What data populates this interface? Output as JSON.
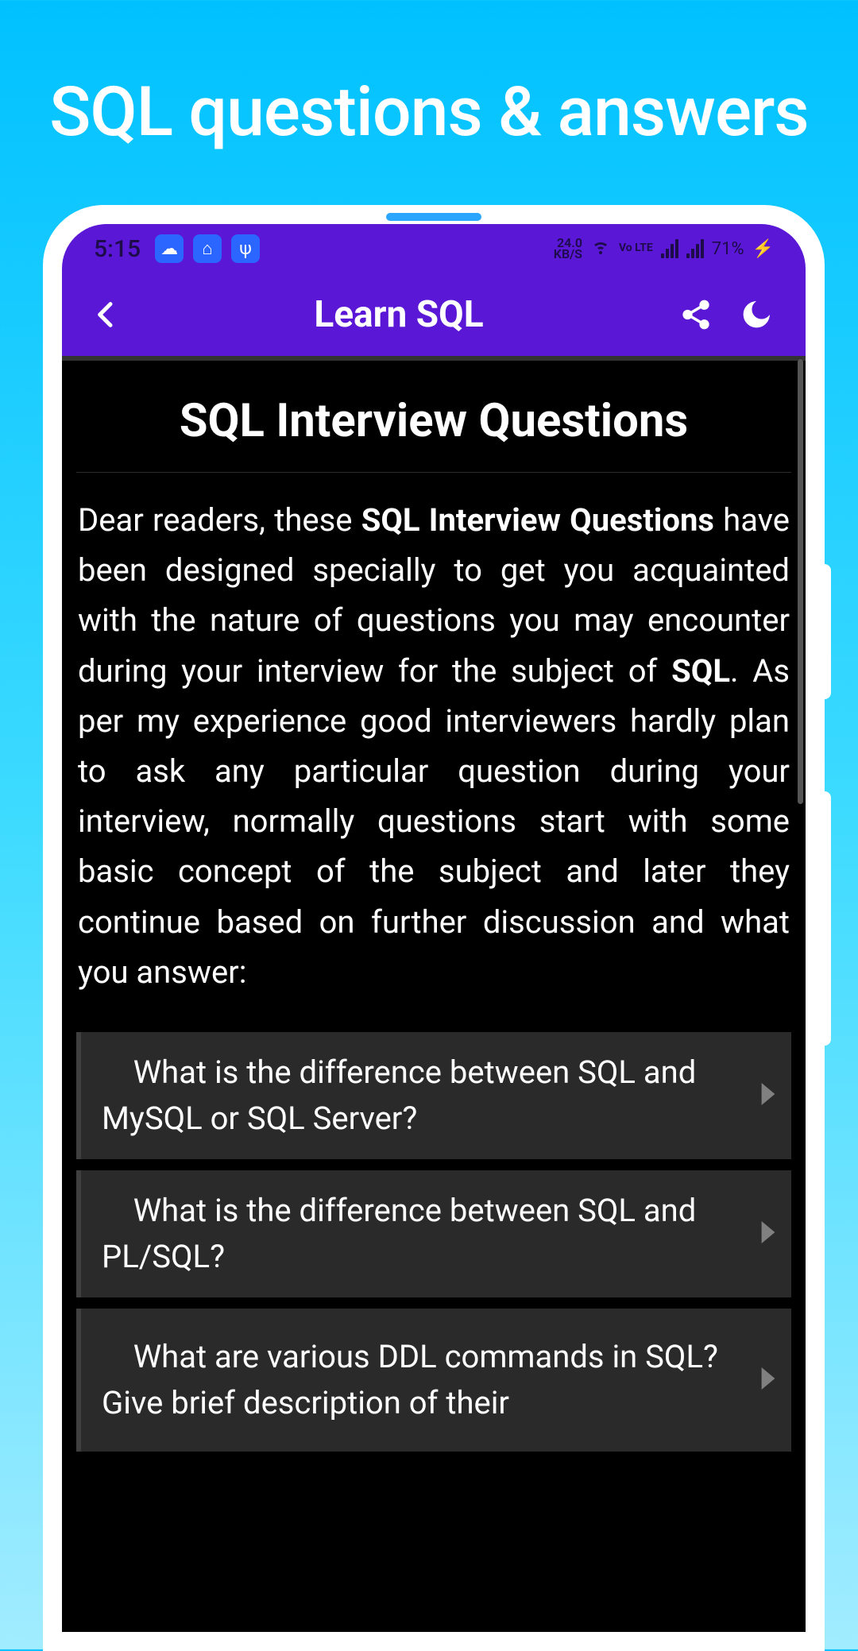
{
  "page_heading": "SQL questions & answers",
  "status": {
    "time": "5:15",
    "netspeed_top": "24.0",
    "netspeed_bottom": "KB/S",
    "volte": "Vo LTE",
    "battery": "71%",
    "charging": "⚡"
  },
  "appbar": {
    "title": "Learn SQL",
    "back_icon": "chevron-left",
    "share_icon": "share",
    "theme_icon": "moon"
  },
  "article": {
    "heading": "SQL Interview Questions",
    "intro_p1": "Dear readers, these ",
    "intro_b1": "SQL Interview Questions",
    "intro_p2": " have been designed specially to get you acquainted with the nature of questions you may encounter during your interview for the subject of ",
    "intro_b2": "SQL",
    "intro_p3": ". As per my experience good interviewers hardly plan to ask any particular question during your interview, normally questions start with some basic concept of the subject and later they continue based on further discussion and what you answer:"
  },
  "questions": [
    {
      "text": "What is the difference between SQL and MySQL or SQL Server?"
    },
    {
      "text": "What is the difference between SQL and PL/SQL?"
    },
    {
      "text": "What are various DDL commands in SQL? Give brief description of their"
    }
  ]
}
